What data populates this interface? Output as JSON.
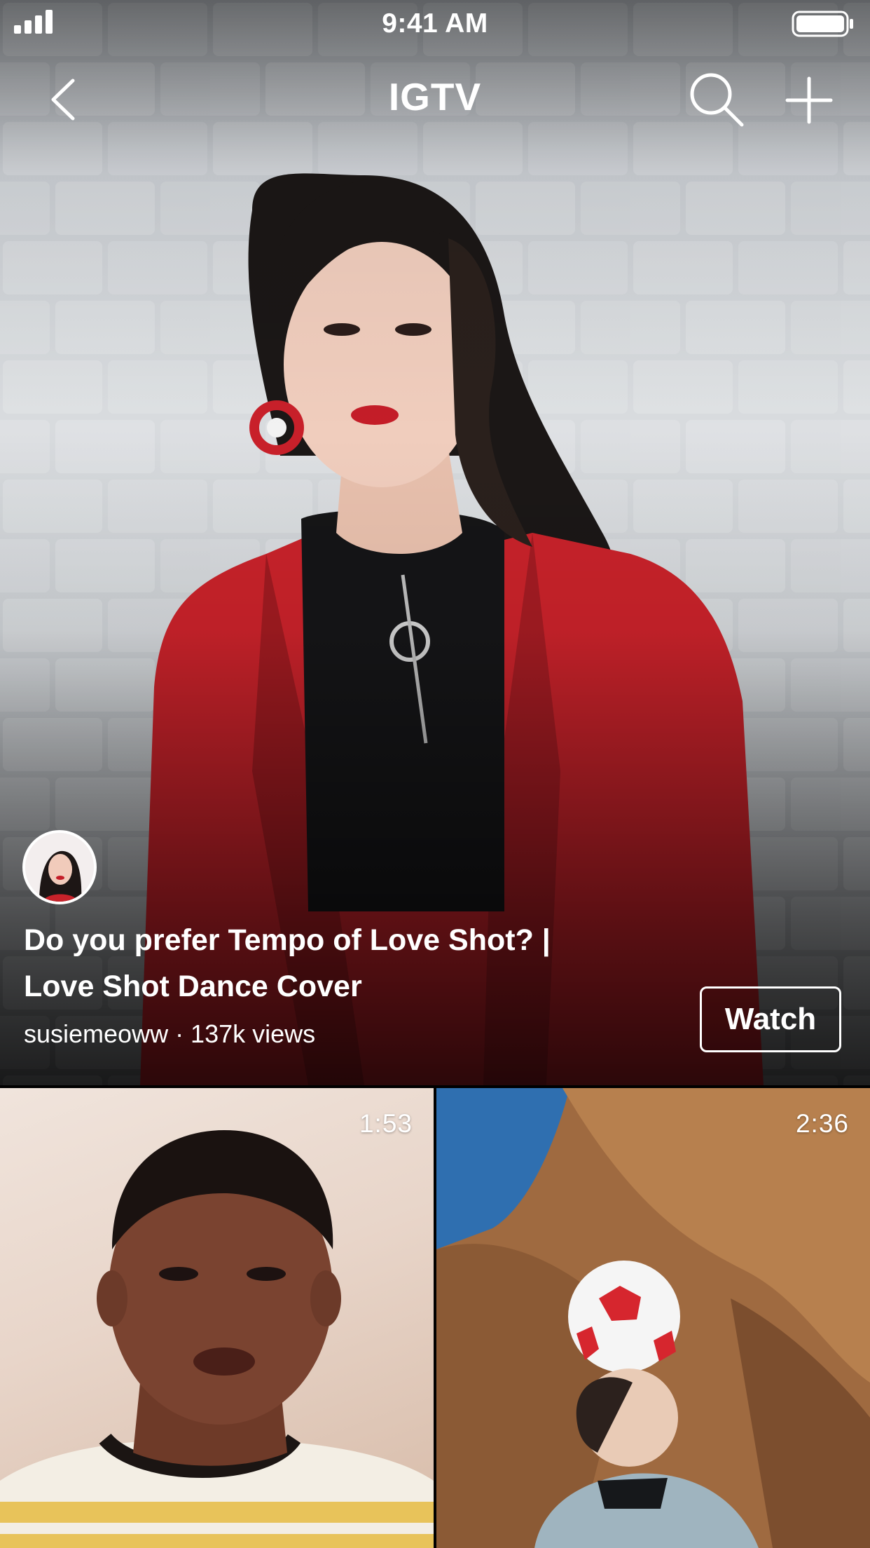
{
  "status_bar": {
    "time": "9:41 AM",
    "signal_icon": "signal-bars-icon",
    "battery_icon": "battery-full-icon"
  },
  "nav": {
    "title": "IGTV",
    "back_icon": "chevron-left-icon",
    "search_icon": "search-icon",
    "add_icon": "plus-icon"
  },
  "featured": {
    "title": "Do you prefer Tempo of Love Shot? | Love Shot Dance Cover",
    "title_line1": "Do you prefer Tempo of Love Shot? |",
    "title_line2": "Love Shot Dance Cover",
    "meta": "susiemeoww · 137k views",
    "watch_label": "Watch"
  },
  "videos": [
    {
      "duration": "1:53"
    },
    {
      "duration": "2:36"
    }
  ],
  "colors": {
    "text": "#ffffff",
    "background": "#000000",
    "jacket_red": "#c8222a"
  }
}
